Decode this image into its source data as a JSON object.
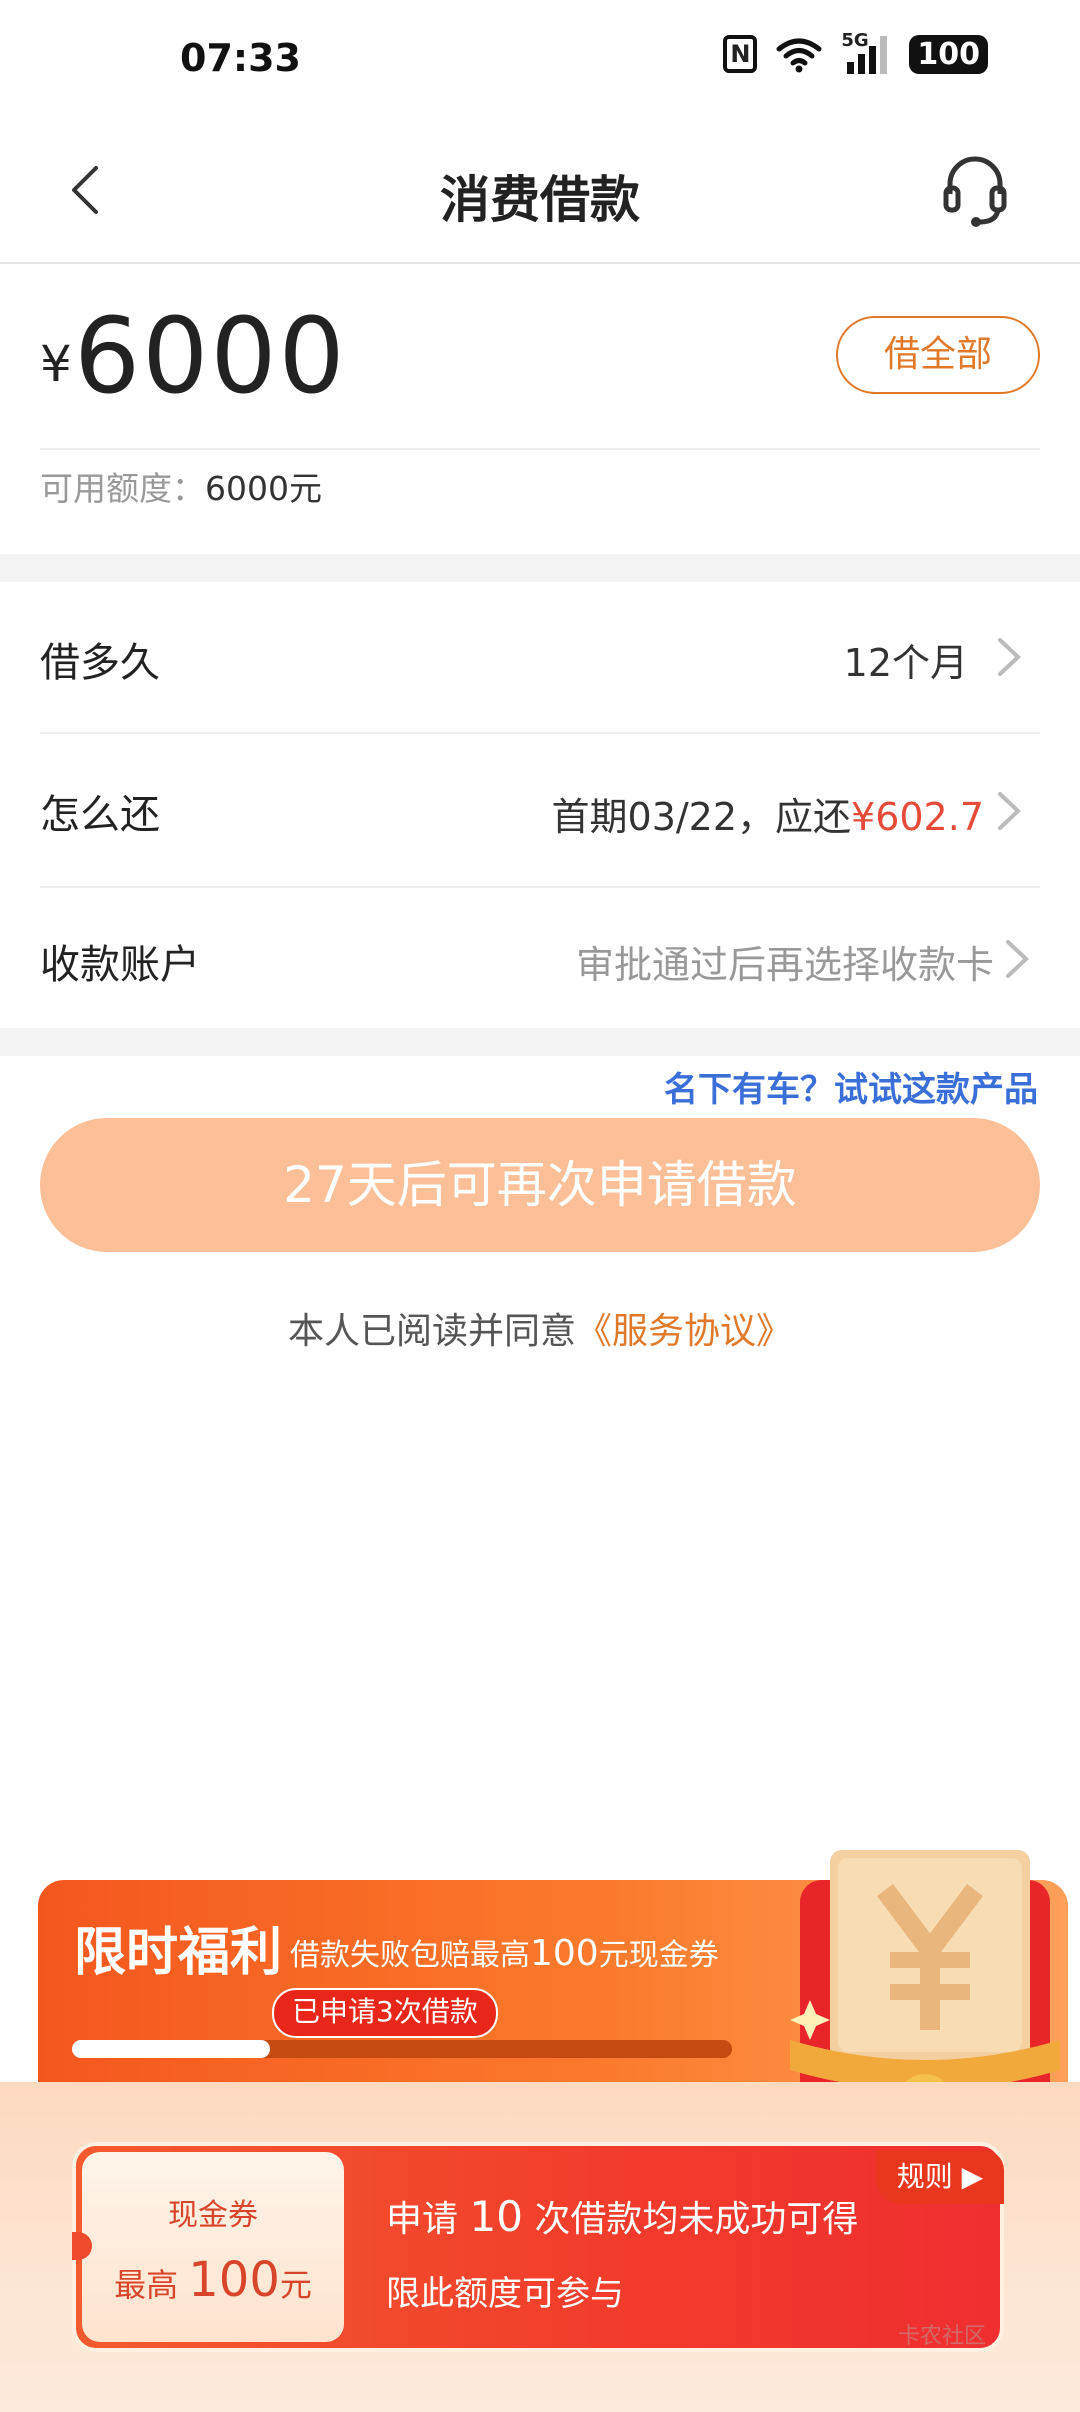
{
  "status_bar": {
    "time": "07:33",
    "network": "5G",
    "battery": "100"
  },
  "nav": {
    "title": "消费借款",
    "back_icon": "chevron-left-icon",
    "service_icon": "headset-icon"
  },
  "amount": {
    "currency": "¥",
    "value": "6000",
    "borrow_all_label": "借全部"
  },
  "available": {
    "label": "可用额度：",
    "value": "6000元"
  },
  "rows": {
    "term": {
      "label": "借多久",
      "value": "12个月"
    },
    "repay": {
      "label": "怎么还",
      "value_prefix": "首期03/22，应还",
      "value_amount": "¥602.7"
    },
    "account": {
      "label": "收款账户",
      "value": "审批通过后再选择收款卡"
    }
  },
  "promo_link": "名下有车？试试这款产品",
  "apply_button": "27天后可再次申请借款",
  "agreement": {
    "prefix": "本人已阅读并同意",
    "link": "《服务协议》"
  },
  "welfare": {
    "title": "限时福利",
    "subtitle_prefix": "借款失败包赔最高",
    "subtitle_amount": "100",
    "subtitle_suffix": "元现金券",
    "badge": "已申请3次借款",
    "progress": 0.3
  },
  "coupon": {
    "label": "现金券",
    "max_prefix": "最高",
    "max_amount": "100",
    "max_unit": "元",
    "line1_prefix": "申请",
    "line1_count": "10",
    "line1_suffix": "次借款均未成功可得",
    "line2": "限此额度可参与",
    "rules": "规则 ▶"
  },
  "watermark": "卡农社区",
  "colors": {
    "accent": "#e07a2a",
    "red": "#e84a3a",
    "link_blue": "#3b6fd8",
    "button_bg": "#fdbf97"
  }
}
